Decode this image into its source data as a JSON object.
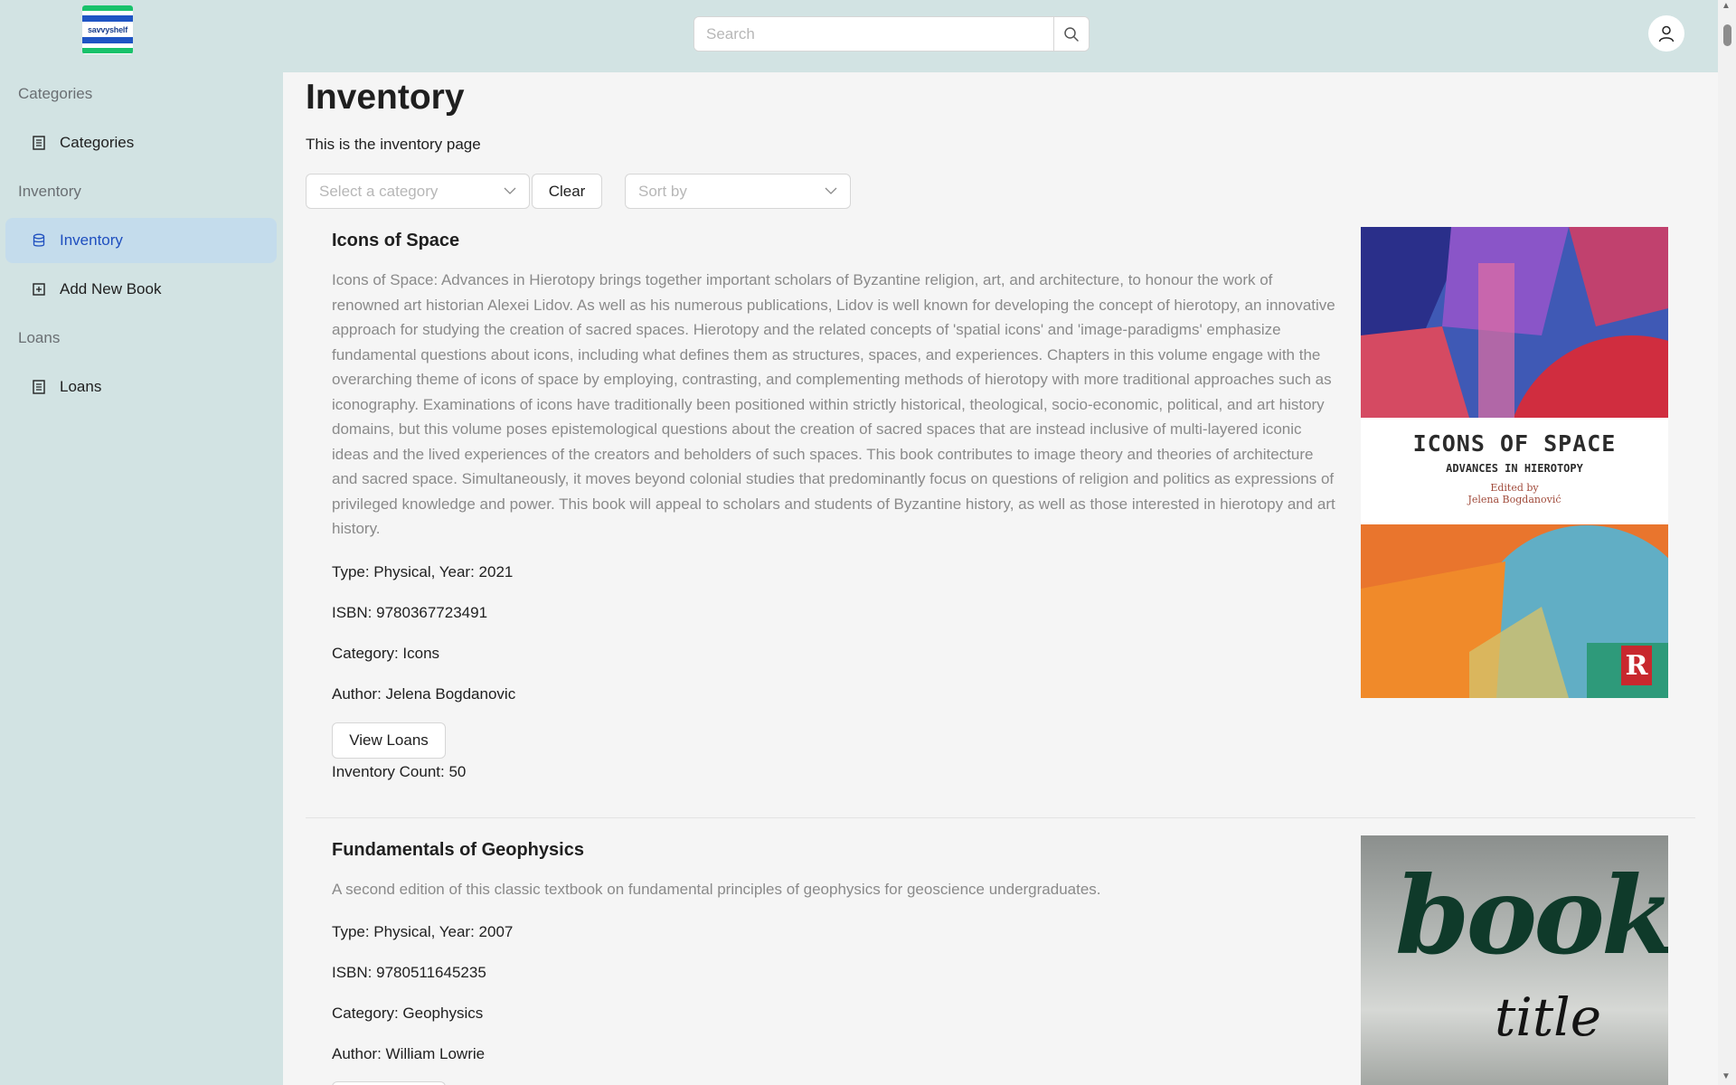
{
  "header": {
    "logo_text": "savvyshelf",
    "search": {
      "placeholder": "Search",
      "value": ""
    },
    "icons": {
      "search": "search-icon",
      "user": "user-icon"
    }
  },
  "sidebar": {
    "groups": [
      {
        "label": "Categories",
        "items": [
          {
            "label": "Categories",
            "icon": "list-icon",
            "active": false
          }
        ]
      },
      {
        "label": "Inventory",
        "items": [
          {
            "label": "Inventory",
            "icon": "database-icon",
            "active": true
          },
          {
            "label": "Add New Book",
            "icon": "plus-square-icon",
            "active": false
          }
        ]
      },
      {
        "label": "Loans",
        "items": [
          {
            "label": "Loans",
            "icon": "list-icon",
            "active": false
          }
        ]
      }
    ]
  },
  "main": {
    "title": "Inventory",
    "subtitle": "This is the inventory page",
    "filters": {
      "category_placeholder": "Select a category",
      "clear_label": "Clear",
      "sort_placeholder": "Sort by"
    },
    "books": [
      {
        "title": "Icons of Space",
        "description": "Icons of Space: Advances in Hierotopy brings together important scholars of Byzantine religion, art, and architecture, to honour the work of renowned art historian Alexei Lidov. As well as his numerous publications, Lidov is well known for developing the concept of hierotopy, an innovative approach for studying the creation of sacred spaces. Hierotopy and the related concepts of 'spatial icons' and 'image-paradigms' emphasize fundamental questions about icons, including what defines them as structures, spaces, and experiences. Chapters in this volume engage with the overarching theme of icons of space by employing, contrasting, and complementing methods of hierotopy with more traditional approaches such as iconography. Examinations of icons have traditionally been positioned within strictly historical, theological, socio-economic, political, and art history domains, but this volume poses epistemological questions about the creation of sacred spaces that are instead inclusive of multi-layered iconic ideas and the lived experiences of the creators and beholders of such spaces. This book contributes to image theory and theories of architecture and sacred space. Simultaneously, it moves beyond colonial studies that predominantly focus on questions of religion and politics as expressions of privileged knowledge and power. This book will appeal to scholars and students of Byzantine history, as well as those interested in hierotopy and art history.",
        "type_year": "Type: Physical, Year: 2021",
        "isbn": "ISBN: 9780367723491",
        "category": "Category: Icons",
        "author": "Author: Jelena Bogdanovic",
        "view_loans_label": "View Loans",
        "inventory_count": "Inventory Count: 50",
        "cover": {
          "title": "ICONS OF SPACE",
          "subtitle": "ADVANCES IN HIEROTOPY",
          "edited_by": "Edited by",
          "editor": "Jelena Bogdanović",
          "publisher_mark": "R"
        }
      },
      {
        "title": "Fundamentals of Geophysics",
        "description": "A second edition of this classic textbook on fundamental principles of geophysics for geoscience undergraduates.",
        "type_year": "Type: Physical, Year: 2007",
        "isbn": "ISBN: 9780511645235",
        "category": "Category: Geophysics",
        "author": "Author: William Lowrie",
        "cover": {
          "word1": "book",
          "word2": "title"
        }
      }
    ]
  },
  "colors": {
    "chrome_bg": "#d2e3e3",
    "active_item_bg": "#c4dcec",
    "active_item_text": "#1f4fbf",
    "content_bg": "#f5f5f5"
  }
}
